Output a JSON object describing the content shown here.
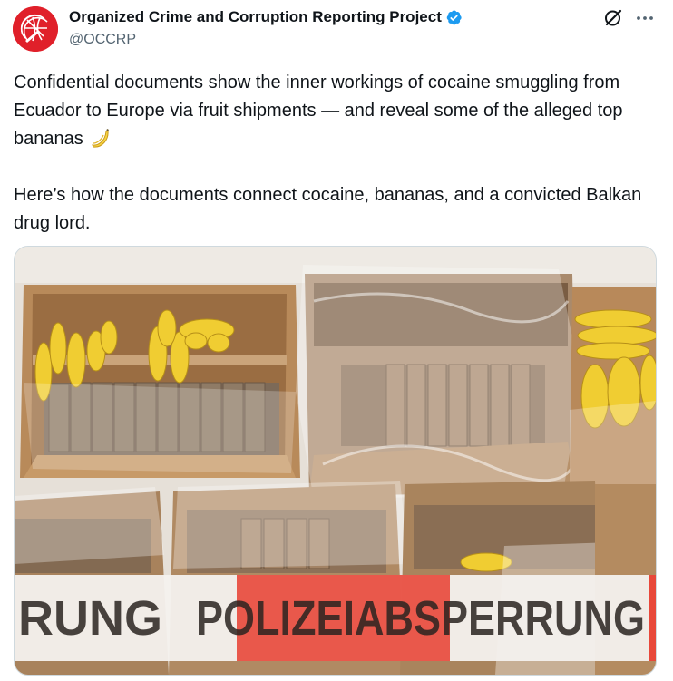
{
  "author": {
    "display_name": "Organized Crime and Corruption Reporting Project",
    "handle": "@OCCRP",
    "avatar_icon": "occrp-globe-logo",
    "verified_icon": "verified-badge-icon",
    "verified_color": "#1d9bf0",
    "brand_color": "#e0202a"
  },
  "header_actions": {
    "grok_icon": "grok-icon",
    "more_icon": "more-options-icon"
  },
  "tweet": {
    "paragraph_1": "Confidential documents show the inner workings of cocaine smuggling from Ecuador to Europe via fruit shipments — and reveal some of the alleged top bananas",
    "emoji": "banana-emoji",
    "paragraph_2": "Here’s how the documents connect cocaine, bananas, and a convicted Balkan drug lord."
  },
  "media": {
    "tape_left_text": "RUNG",
    "tape_right_text": "POLIZEIABSPERRUNG",
    "tape_color": "#e8483a"
  }
}
